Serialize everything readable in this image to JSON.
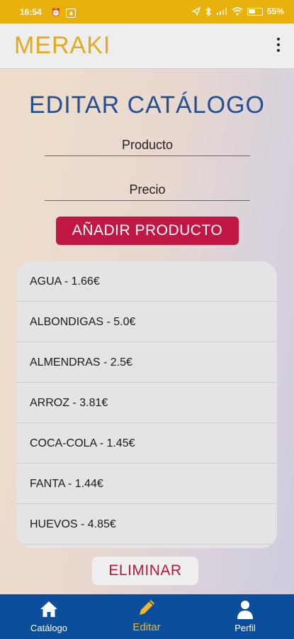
{
  "status_bar": {
    "time": "16:54",
    "battery_percent": "55",
    "battery_level": 0.55
  },
  "app_bar": {
    "brand": "MERAKI",
    "menu_icon": "more-vertical-icon"
  },
  "page": {
    "title": "EDITAR CATÁLOGO",
    "product_placeholder": "Producto",
    "price_placeholder": "Precio",
    "add_button": "AÑADIR PRODUCTO",
    "delete_button": "ELIMINAR"
  },
  "products": [
    "AGUA - 1.66€",
    "ALBONDIGAS - 5.0€",
    "ALMENDRAS - 2.5€",
    "ARROZ - 3.81€",
    "COCA-COLA - 1.45€",
    "FANTA - 1.44€",
    "HUEVOS - 4.85€",
    ""
  ],
  "bottom_nav": {
    "catalog": "Catálogo",
    "edit": "Editar",
    "profile": "Perfil"
  },
  "colors": {
    "accent_yellow": "#e9b10c",
    "brand_blue": "#0b4f9c",
    "title_blue": "#224f8f",
    "button_red": "#c01744"
  }
}
